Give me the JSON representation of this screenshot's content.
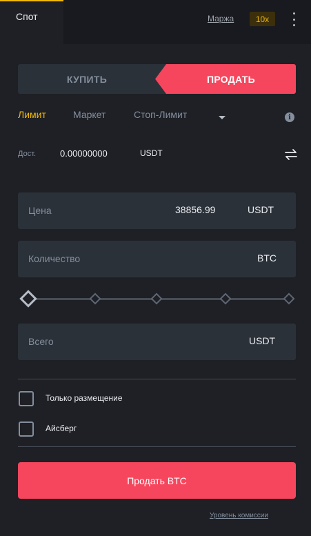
{
  "topbar": {
    "tab_spot": "Спот",
    "margin_link": "Маржа",
    "leverage": "10x"
  },
  "side_switch": {
    "buy_label": "КУПИТЬ",
    "sell_label": "ПРОДАТЬ",
    "selected": "sell"
  },
  "order_types": {
    "limit": "Лимит",
    "market": "Маркет",
    "stop_limit": "Стоп-Лимит",
    "selected": "limit"
  },
  "available": {
    "label": "Дост.",
    "value": "0.00000000",
    "unit": "USDT"
  },
  "price_field": {
    "label": "Цена",
    "value": "38856.99",
    "unit": "USDT"
  },
  "quantity_field": {
    "label": "Количество",
    "value": "",
    "unit": "BTC"
  },
  "slider": {
    "value_percent": 0
  },
  "total_field": {
    "label": "Всего",
    "value": "",
    "unit": "USDT"
  },
  "options": {
    "post_only_label": "Только размещение",
    "post_only_checked": false,
    "iceberg_label": "Айсберг",
    "iceberg_checked": false
  },
  "submit_label": "Продать BTC",
  "fee_link": "Уровень комиссии",
  "colors": {
    "background": "#1e2026",
    "panel": "#2b3139",
    "sell": "#f6465d",
    "accent": "#f0b90b",
    "muted": "#848e9c"
  }
}
